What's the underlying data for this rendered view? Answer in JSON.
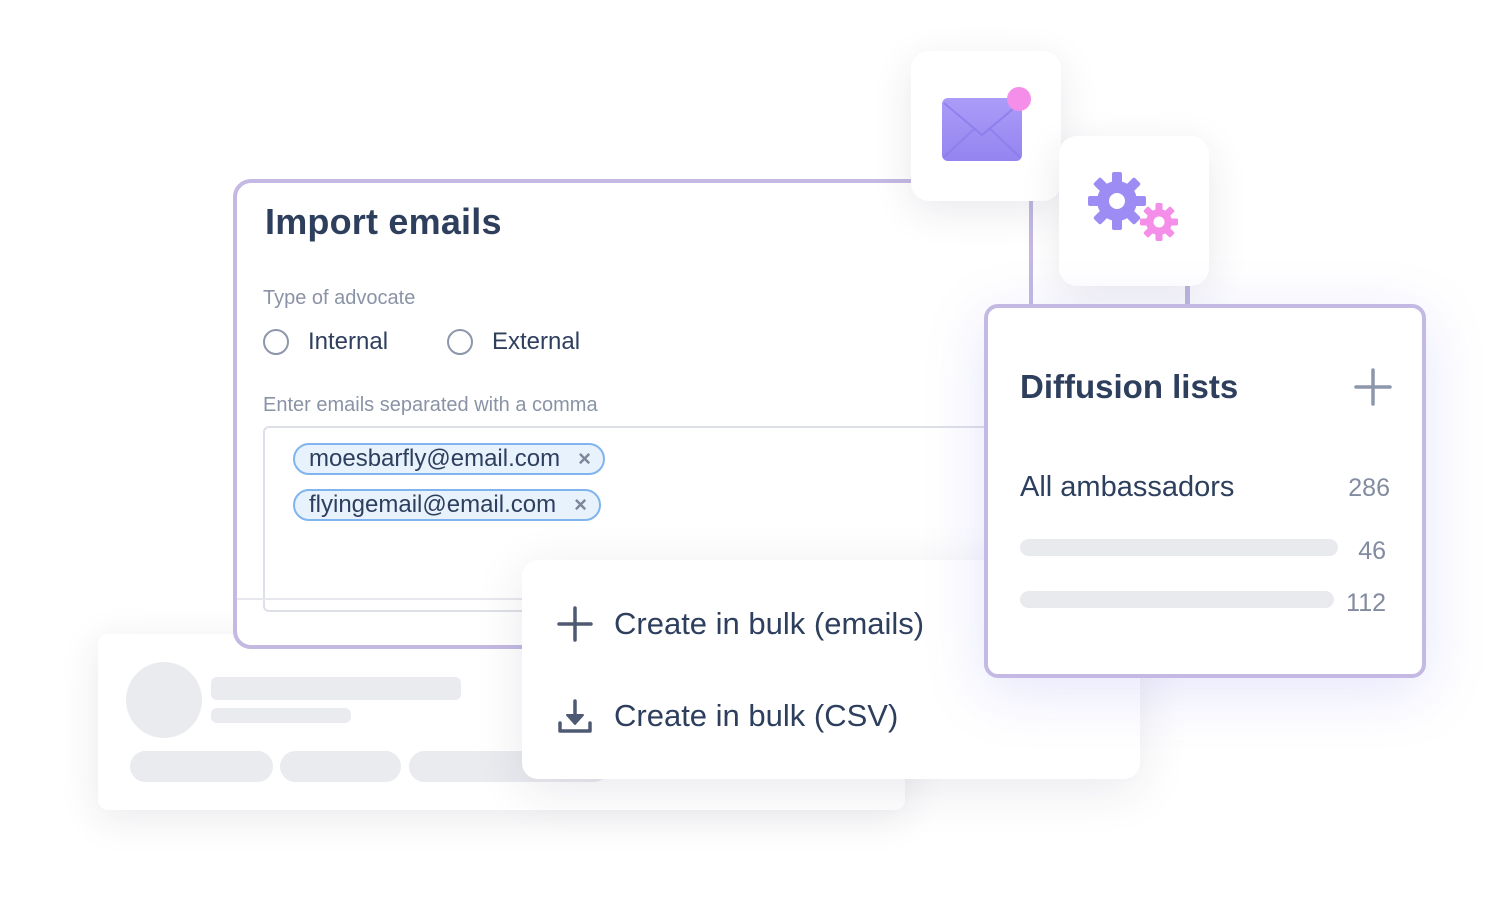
{
  "import_emails": {
    "title": "Import emails",
    "advocate_type_label": "Type of advocate",
    "advocate_options": [
      {
        "label": "Internal",
        "selected": false
      },
      {
        "label": "External",
        "selected": false
      }
    ],
    "emails_label": "Enter emails separated with a comma",
    "email_chips": [
      {
        "value": "moesbarfly@email.com",
        "remove_icon": "×"
      },
      {
        "value": "flyingemail@email.com",
        "remove_icon": "×"
      }
    ]
  },
  "bulk_menu": {
    "items": [
      {
        "icon": "plus-icon",
        "label": "Create in bulk (emails)"
      },
      {
        "icon": "download-icon",
        "label": "Create in bulk (CSV)"
      }
    ]
  },
  "diffusion_lists": {
    "title": "Diffusion lists",
    "add_icon": "plus-icon",
    "lists": [
      {
        "label": "All ambassadors",
        "count": "286"
      },
      {
        "label": "",
        "count": "46"
      },
      {
        "label": "",
        "count": "112"
      }
    ]
  },
  "icons": {
    "mail_tile": "envelope-notification-icon",
    "gear_tile": "gears-icon"
  },
  "colors": {
    "accent_border": "#c3b9e3",
    "chip_border": "#7fb4ee",
    "chip_fill": "#e7f2fd",
    "text_primary": "#2e3f5e",
    "text_muted": "#8a93a6",
    "envelope": "#9f8ff5",
    "notification_dot": "#f58ee8",
    "gear_primary": "#9c8cf3",
    "gear_secondary": "#f58ee8"
  }
}
